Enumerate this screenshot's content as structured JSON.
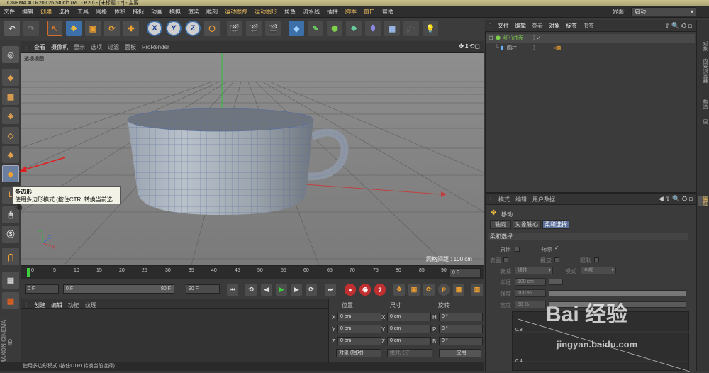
{
  "window": {
    "title": "CINEMA 4D R20.026 Studio (RC - R20) - [未标题 1 *] - 主要"
  },
  "menubar": {
    "items": [
      "文件",
      "编辑",
      "创建",
      "选择",
      "工具",
      "网格",
      "体积",
      "捕捉",
      "动画",
      "模拟",
      "渲染",
      "雕刻",
      "运动跟踪",
      "运动图形",
      "角色",
      "流水线",
      "插件",
      "脚本",
      "窗口",
      "帮助"
    ],
    "layout_label": "界面:",
    "layout_value": "启动"
  },
  "toolbar": {
    "axis_x": "X",
    "axis_y": "Y",
    "axis_z": "Z"
  },
  "viewport": {
    "tabs": [
      "查看",
      "摄像机",
      "显示",
      "选项",
      "过滤",
      "面板",
      "ProRender"
    ],
    "name": "透视视图",
    "grid_spacing": "网格间距 : 100 cm",
    "axis_y": "Y",
    "axis_z": "Z",
    "axis_x": "X"
  },
  "tooltip": {
    "title": "多边形",
    "text": "使用多边形模式 (按住CTRL转换当前选择)"
  },
  "timeline": {
    "ticks": [
      "0",
      "5",
      "10",
      "15",
      "20",
      "25",
      "30",
      "35",
      "40",
      "45",
      "50",
      "55",
      "60",
      "65",
      "70",
      "75",
      "80",
      "85",
      "90"
    ],
    "end_frame": "0 F"
  },
  "playback": {
    "current": "0 F",
    "range_start": "0 F",
    "range_end": "90 F",
    "max": "90 F"
  },
  "material": {
    "tabs": [
      "创建",
      "编辑",
      "功能",
      "纹理"
    ]
  },
  "coords": {
    "headers": [
      "位置",
      "尺寸",
      "旋转"
    ],
    "rows": [
      {
        "pos_label": "X",
        "pos": "0 cm",
        "size_label": "X",
        "size": "0 cm",
        "rot_label": "H",
        "rot": "0 °"
      },
      {
        "pos_label": "Y",
        "pos": "0 cm",
        "size_label": "Y",
        "size": "0 cm",
        "rot_label": "P",
        "rot": "0 °"
      },
      {
        "pos_label": "Z",
        "pos": "0 cm",
        "size_label": "Z",
        "size": "0 cm",
        "rot_label": "B",
        "rot": "0 °"
      }
    ],
    "mode": "对象 (相对)",
    "size_mode": "绝对尺寸",
    "apply": "应用"
  },
  "object_manager": {
    "tabs": [
      "文件",
      "编辑",
      "查看",
      "对象",
      "标签",
      "书签"
    ],
    "objects": [
      {
        "name": "细分曲面"
      },
      {
        "name": "圆柱"
      }
    ]
  },
  "attributes": {
    "tabs": [
      "模式",
      "编辑",
      "用户数据"
    ],
    "title": "移动",
    "subtabs": [
      "轴向",
      "对象轴心",
      "柔和选择"
    ],
    "section": "柔和选择",
    "row1": [
      "启用",
      "预览"
    ],
    "row2": [
      "表面",
      "橡皮",
      "限制"
    ],
    "falloff_label": "衰减",
    "falloff_value": "线性",
    "mode_label": "模式",
    "mode_value": "全部",
    "radius_label": "半径",
    "radius_value": "100 cm",
    "strength_label": "强度",
    "strength_value": "100 %",
    "width_label": "宽度",
    "width_value": "50 %",
    "graph_y1": "0.8",
    "graph_y2": "0.4"
  },
  "right_tabs": [
    "对象",
    "内容浏览器",
    "构造",
    "层"
  ],
  "attr_side_tab": "属性",
  "status": "使用多边形模式 (按住CTRL转换当前选择)",
  "brand": "MAXON CINEMA 4D",
  "watermark": {
    "text": "Bai 经验",
    "url": "jingyan.baidu.com"
  }
}
